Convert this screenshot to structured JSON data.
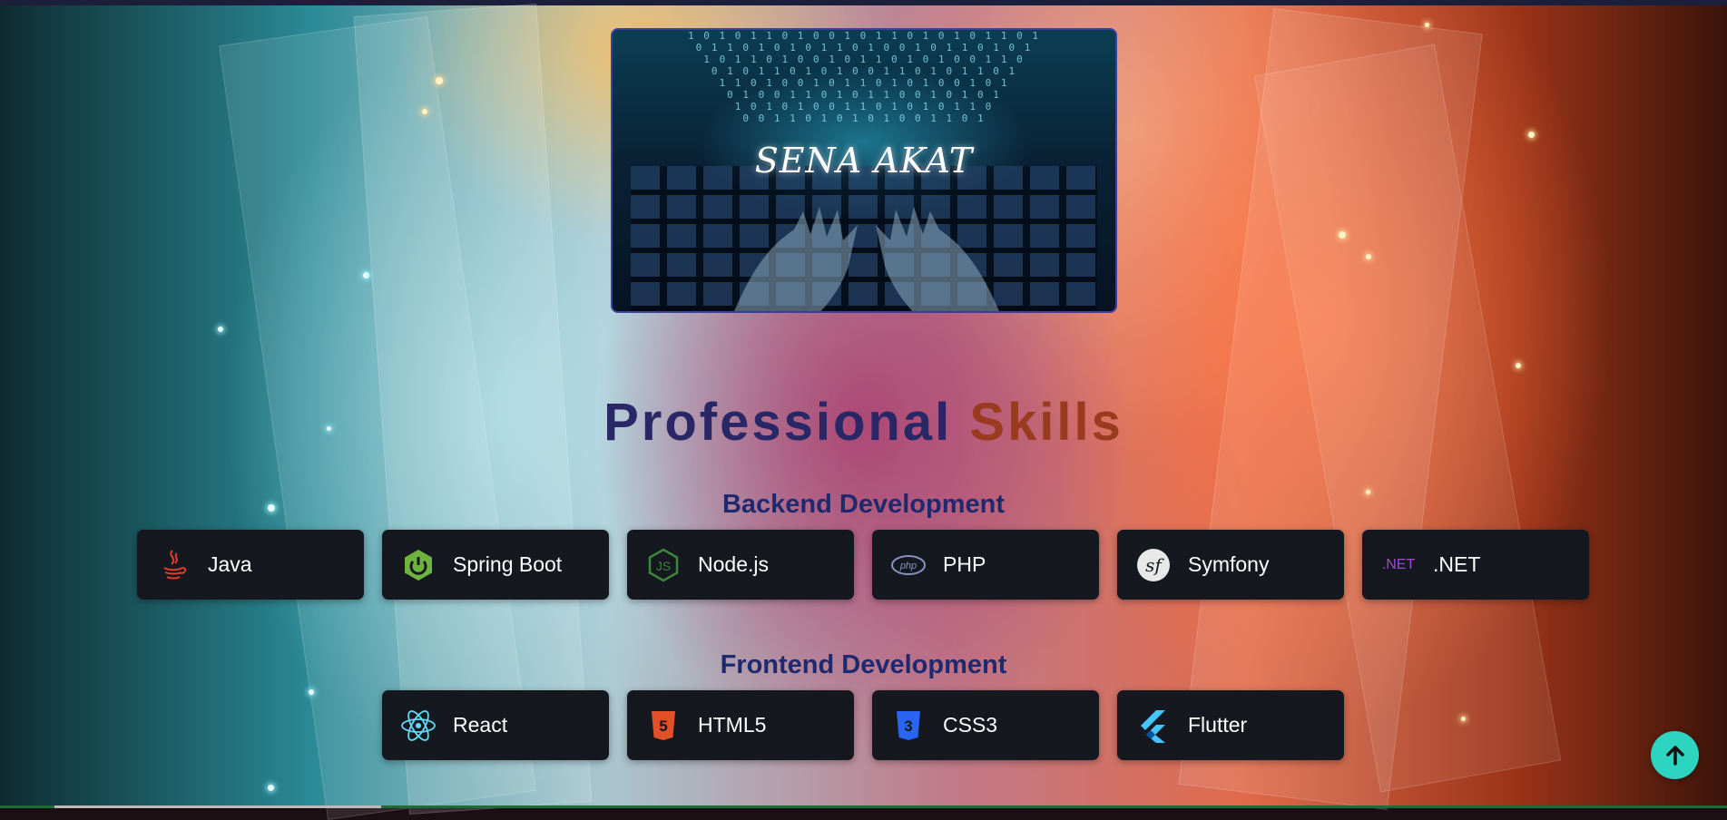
{
  "hero": {
    "name": "SENA AKAT",
    "code_rain": "1 0 1 0 1 1 0 1 0 0 1 0 1 1 0 1 0 1 0 1 1 0 1\n0 1 1 0 1 0 1 0 1 1 0 1 0 0 1 0 1 1 0 1 0 1\n1 0 1 1 0 1 0 0 1 0 1 1 0 1 0 1 0 0 1 1 0\n0 1 0 1 1 0 1 0 1 0 0 1 1 0 1 0 1 1 0 1\n1 1 0 1 0 0 1 0 1 1 0 1 0 1 0 0 1 0 1\n0 1 0 0 1 1 0 1 0 1 1 0 0 1 0 1 0 1\n1 0 1 0 1 0 0 1 1 0 1 0 1 0 1 1 0\n0 0 1 1 0 1 0 1 0 1 0 0 1 1 0 1"
  },
  "title": {
    "word1": "Professional",
    "word2": "Skills"
  },
  "backend": {
    "heading": "Backend Development",
    "items": [
      {
        "label": "Java",
        "icon": "java-icon",
        "color": "#e23d28"
      },
      {
        "label": "Spring Boot",
        "icon": "spring-boot-icon",
        "color": "#6db33f"
      },
      {
        "label": "Node.js",
        "icon": "nodejs-icon",
        "color": "#3c873a"
      },
      {
        "label": "PHP",
        "icon": "php-icon",
        "color": "#8892bf"
      },
      {
        "label": "Symfony",
        "icon": "symfony-icon",
        "color": "#ffffff"
      },
      {
        "label": ".NET",
        "icon": "dotnet-icon",
        "color": "#9b4dca",
        "icon_text": ".NET"
      }
    ]
  },
  "frontend": {
    "heading": "Frontend Development",
    "items": [
      {
        "label": "React",
        "icon": "react-icon",
        "color": "#61dafb"
      },
      {
        "label": "HTML5",
        "icon": "html5-icon",
        "color": "#e34f26"
      },
      {
        "label": "CSS3",
        "icon": "css3-icon",
        "color": "#2965f1"
      },
      {
        "label": "Flutter",
        "icon": "flutter-icon",
        "color": "#47c5fb"
      }
    ]
  },
  "scroll_top": {
    "icon": "arrow-up-icon"
  }
}
